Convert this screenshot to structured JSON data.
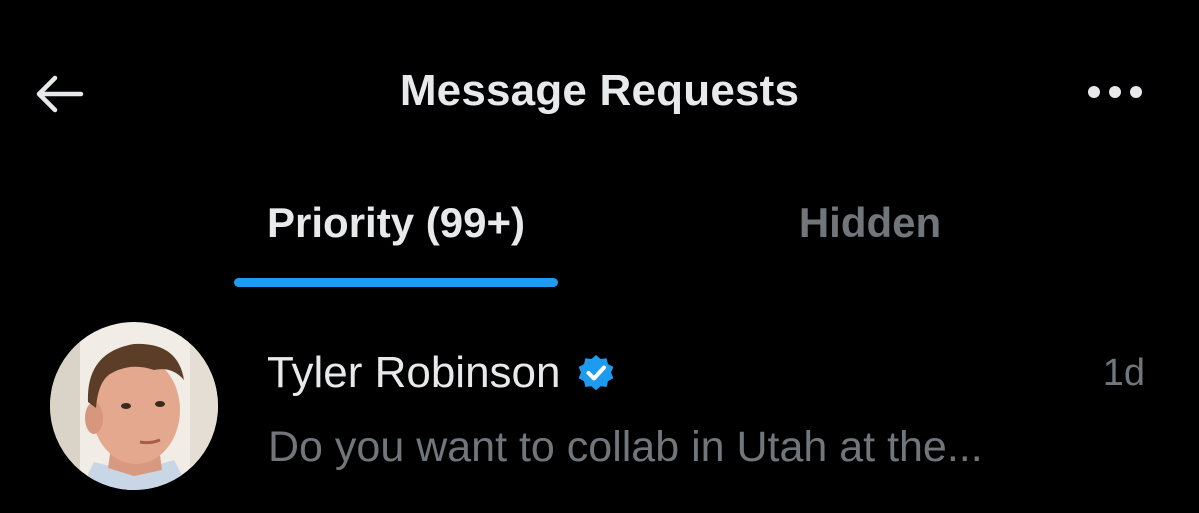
{
  "header": {
    "title": "Message Requests",
    "back_icon": "arrow-left-icon",
    "more_icon": "more-horizontal-icon"
  },
  "tabs": [
    {
      "label": "Priority (99+)",
      "active": true
    },
    {
      "label": "Hidden",
      "active": false
    }
  ],
  "conversations": [
    {
      "sender": "Tyler Robinson",
      "verified": true,
      "time": "1d",
      "preview": "Do you want to collab in Utah at the..."
    }
  ],
  "colors": {
    "background": "#000000",
    "primary_text": "#e7e9ea",
    "secondary_text": "#71767b",
    "accent": "#1d9bf0"
  }
}
